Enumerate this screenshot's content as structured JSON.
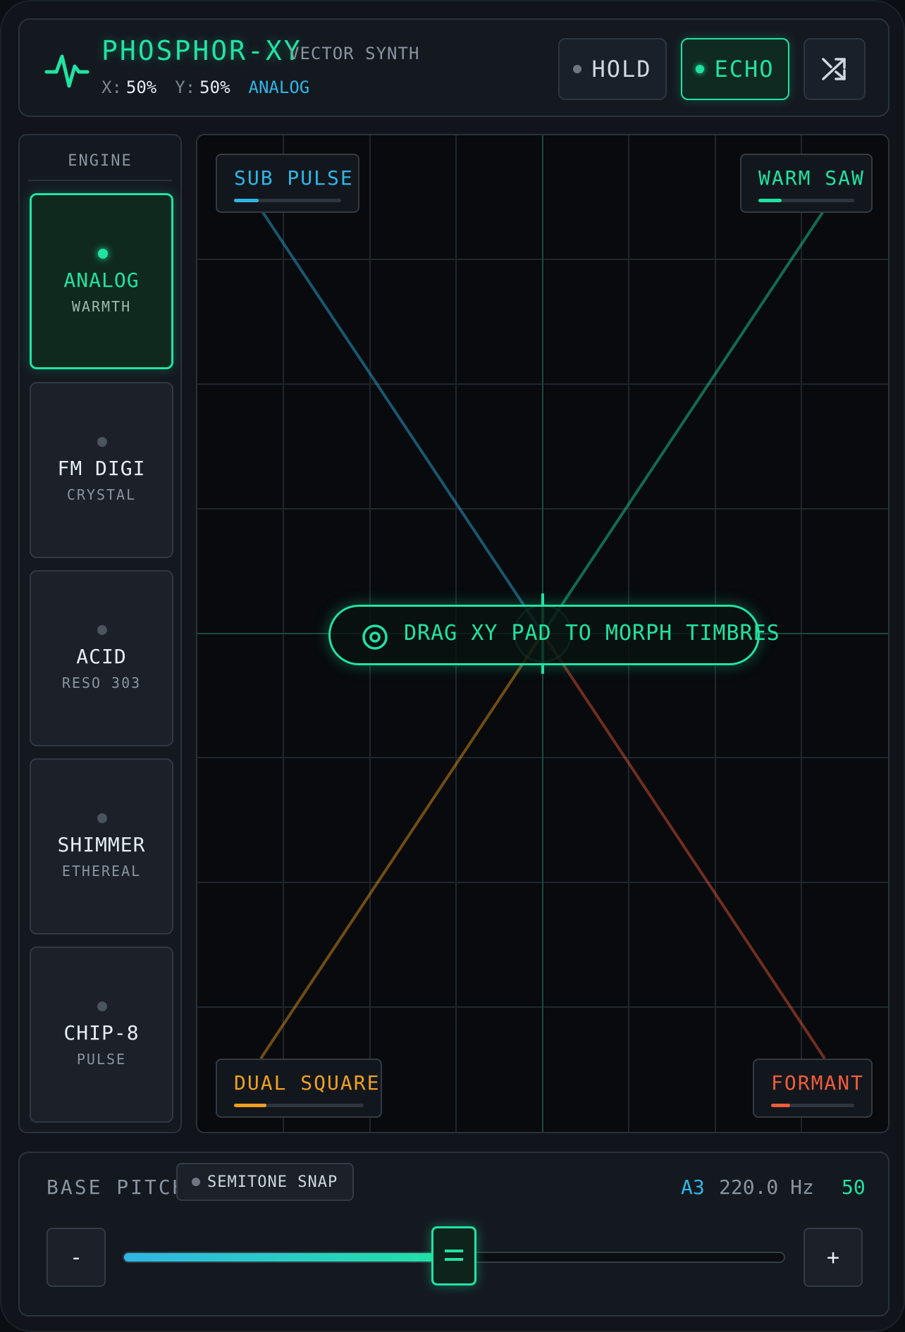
{
  "header": {
    "title": "PHOSPHOR-XY",
    "subtitle": "VECTOR SYNTH",
    "x_label": "X:",
    "x_value": "50%",
    "y_label": "Y:",
    "y_value": "50%",
    "engine_readout": "ANALOG",
    "hold_label": "HOLD",
    "echo_label": "ECHO",
    "hold_active": false,
    "echo_active": true,
    "shuffle_icon": "shuffle-icon",
    "logo_icon": "pulse-wave-icon"
  },
  "engine_panel": {
    "title": "ENGINE",
    "items": [
      {
        "name": "ANALOG",
        "desc": "WARMTH",
        "active": true
      },
      {
        "name": "FM DIGI",
        "desc": "CRYSTAL",
        "active": false
      },
      {
        "name": "ACID",
        "desc": "RESO 303",
        "active": false
      },
      {
        "name": "SHIMMER",
        "desc": "ETHEREAL",
        "active": false
      },
      {
        "name": "CHIP-8",
        "desc": "PULSE",
        "active": false
      }
    ]
  },
  "xy_pad": {
    "hint": "DRAG XY PAD TO MORPH TIMBRES",
    "hint_icon": "target-icon",
    "cursor_x": 0.5,
    "cursor_y": 0.5,
    "corners": {
      "top_left": {
        "label": "SUB PULSE",
        "color": "#2fb6e6",
        "level": 0.23
      },
      "top_right": {
        "label": "WARM SAW",
        "color": "#20e3a2",
        "level": 0.24
      },
      "bottom_left": {
        "label": "DUAL SQUARE",
        "color": "#f0a020",
        "level": 0.25
      },
      "bottom_right": {
        "label": "FORMANT",
        "color": "#f25c3a",
        "level": 0.23
      }
    }
  },
  "pitch": {
    "label": "BASE PITCH",
    "snap_label": "SEMITONE SNAP",
    "snap_active": false,
    "note": "A3",
    "frequency": "220.0 Hz",
    "value": "50",
    "minus_label": "-",
    "plus_label": "+",
    "level": 0.5
  },
  "colors": {
    "accent": "#20e3a2",
    "blue": "#2fb6e6",
    "orange": "#f0a020",
    "red": "#f25c3a"
  }
}
